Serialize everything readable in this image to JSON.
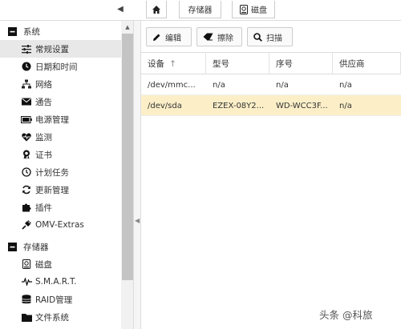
{
  "breadcrumb": {
    "storage": "存储器",
    "disk": "磁盘"
  },
  "sidebar": {
    "groups": [
      {
        "label": "系统",
        "items": [
          {
            "label": "常规设置",
            "icon": "sliders-icon"
          },
          {
            "label": "日期和时间",
            "icon": "clock-icon"
          },
          {
            "label": "网络",
            "icon": "network-icon"
          },
          {
            "label": "通告",
            "icon": "envelope-icon"
          },
          {
            "label": "电源管理",
            "icon": "battery-icon"
          },
          {
            "label": "监测",
            "icon": "heartbeat-icon"
          },
          {
            "label": "证书",
            "icon": "certificate-icon"
          },
          {
            "label": "计划任务",
            "icon": "clock-icon"
          },
          {
            "label": "更新管理",
            "icon": "refresh-icon"
          },
          {
            "label": "插件",
            "icon": "puzzle-icon"
          },
          {
            "label": "OMV-Extras",
            "icon": "plug-icon"
          }
        ]
      },
      {
        "label": "存储器",
        "items": [
          {
            "label": "磁盘",
            "icon": "disk-icon"
          },
          {
            "label": "S.M.A.R.T.",
            "icon": "pulse-icon"
          },
          {
            "label": "RAID管理",
            "icon": "database-icon"
          },
          {
            "label": "文件系统",
            "icon": "folder-icon"
          }
        ]
      }
    ]
  },
  "toolbar": {
    "edit": "编辑",
    "wipe": "擦除",
    "scan": "扫描"
  },
  "table": {
    "columns": [
      "设备",
      "型号",
      "序号",
      "供应商"
    ],
    "sort_indicator": "↑",
    "rows": [
      [
        "/dev/mmc...",
        "n/a",
        "n/a",
        "n/a"
      ],
      [
        "/dev/sda",
        "EZEX-08Y2...",
        "WD-WCC3F...",
        "n/a"
      ]
    ]
  },
  "watermark": "头条 @科旅",
  "colors": {
    "selected_row": "#fcefc8",
    "active_nav": "#e8e8e8"
  }
}
